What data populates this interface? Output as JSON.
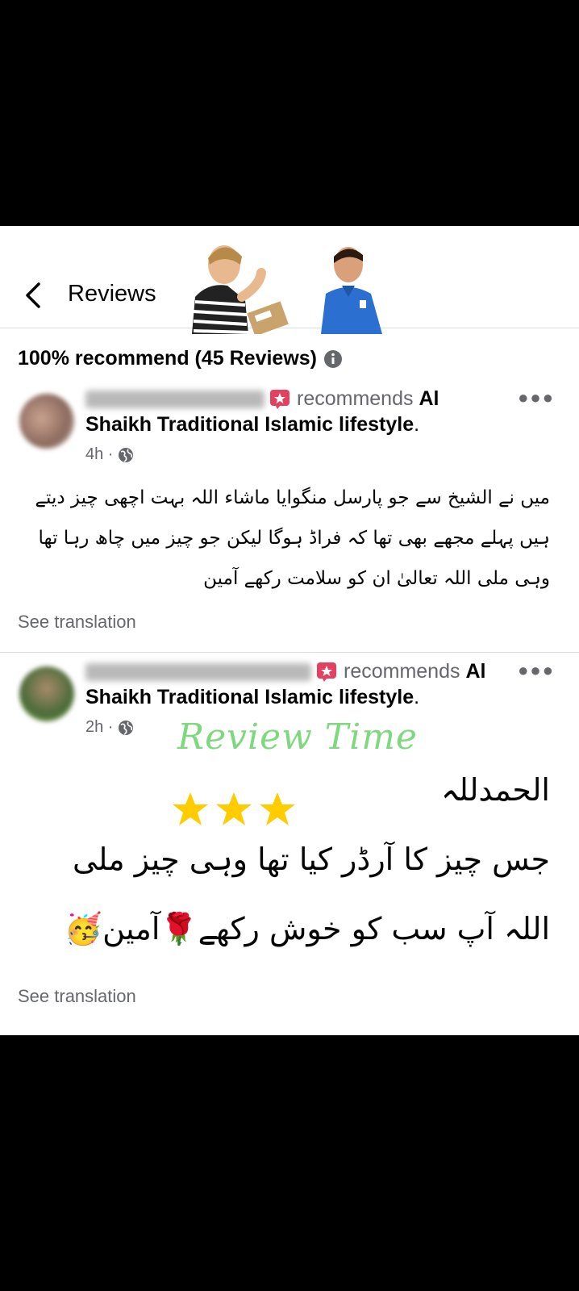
{
  "header": {
    "title": "Reviews"
  },
  "summary": {
    "text": "100% recommend (45 Reviews)"
  },
  "reviews": [
    {
      "recommends": "recommends",
      "page_name_start": "Al",
      "page_name_rest": "Shaikh  Traditional Islamic lifestyle",
      "time": "4h ·",
      "body_lines": [
        "میں نے الشیخ سے جو پارسل منگوایا ماشاء اللہ بہت اچھی چیز دیتے",
        "ہیں پہلے مجھے بھی تھا کہ فراڈ ہوگا لیکن جو چیز میں چاھ رہا تھا",
        "وہی ملی اللہ تعالیٰ ان کو سلامت رکھے آمین"
      ],
      "see_translation": "See translation"
    },
    {
      "recommends": "recommends",
      "page_name_start": "Al",
      "page_name_rest": "Shaikh  Traditional Islamic lifestyle",
      "time": "2h ·",
      "body_lines": [
        "الحمدللہ",
        "جس چیز کا آرڈر کیا تھا وہی چیز ملی",
        "اللہ آپ سب کو خوش رکھے🌹آمین🥳"
      ],
      "see_translation": "See translation"
    }
  ],
  "overlay": {
    "review_time": "Review Time",
    "stars": 3
  },
  "colors": {
    "accent_badge": "#e4405f",
    "overlay_green": "#7ed97e",
    "star": "#ffcc00",
    "muted": "#65676b"
  }
}
